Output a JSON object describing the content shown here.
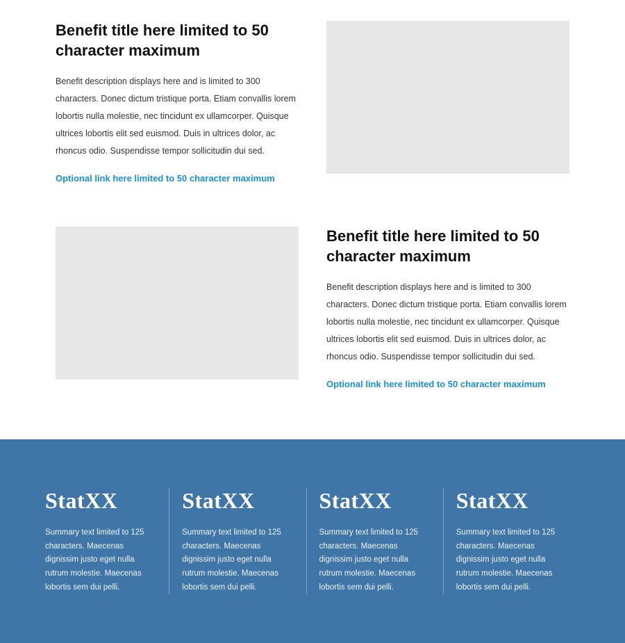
{
  "benefits": [
    {
      "title": "Benefit title here limited to 50 character maximum",
      "description": "Benefit description displays here and is limited to 300 characters. Donec dictum tristique porta. Etiam convallis lorem lobortis nulla molestie, nec tincidunt ex ullamcorper. Quisque ultrices lobortis elit sed euismod. Duis in ultrices dolor, ac rhoncus odio. Suspendisse tempor sollicitudin dui sed.",
      "link_text": "Optional link here limited to 50 character maximum"
    },
    {
      "title": "Benefit title here limited to 50 character maximum",
      "description": "Benefit description displays here and is limited to 300 characters. Donec dictum tristique porta. Etiam convallis lorem lobortis nulla molestie, nec tincidunt ex ullamcorper. Quisque ultrices lobortis elit sed euismod. Duis in ultrices dolor, ac rhoncus odio. Suspendisse tempor sollicitudin dui sed.",
      "link_text": "Optional link here limited to 50 character maximum"
    }
  ],
  "stats": [
    {
      "title": "StatXX",
      "summary": "Summary text limited to 125 characters. Maecenas dignissim justo eget nulla rutrum molestie. Maecenas lobortis sem dui pelli."
    },
    {
      "title": "StatXX",
      "summary": "Summary text limited to 125 characters. Maecenas dignissim justo eget nulla rutrum molestie. Maecenas lobortis sem dui pelli."
    },
    {
      "title": "StatXX",
      "summary": "Summary text limited to 125 characters. Maecenas dignissim justo eget nulla rutrum molestie. Maecenas lobortis sem dui pelli."
    },
    {
      "title": "StatXX",
      "summary": "Summary text limited to 125 characters. Maecenas dignissim justo eget nulla rutrum molestie. Maecenas lobortis sem dui pelli."
    }
  ],
  "colors": {
    "link": "#1a8fd6",
    "stats_bg": "#3f76a7",
    "placeholder": "#e7e7e7"
  }
}
